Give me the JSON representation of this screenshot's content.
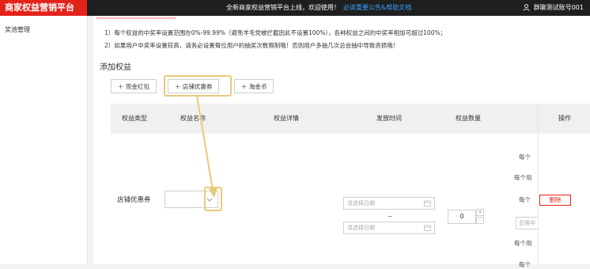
{
  "header": {
    "brand": "商家权益营销平台",
    "notice": "全新商家权益营销平台上线，欢迎使用！",
    "notice_link": "必读重要公告&帮助文档",
    "account": "群聊测试账号001"
  },
  "sidebar": {
    "items": [
      {
        "label": "奖池管理"
      }
    ]
  },
  "tips": {
    "line1": "1）每个权益的中奖率设置范围在0%-99.99%（避免羊毛党被拦截因此不设置100%），各种权益之间的中奖率相加可超过100%；",
    "line2": "2）如果用户中奖率设置较高，请务必设置每位用户的抽奖次数限制哦！否则用户多抽几次总会抽中导致资损哦！"
  },
  "section": {
    "title": "添加权益"
  },
  "buttons": {
    "cash_red_packet": "现金红包",
    "shop_coupon": "店铺优惠券",
    "taojinbi": "淘金币"
  },
  "table": {
    "headers": [
      "权益类型",
      "权益名称",
      "权益详情",
      "发放时间",
      "权益数量",
      "操作"
    ],
    "row": {
      "type": "店铺优惠券",
      "date_placeholder_start": "请选择日期",
      "date_separator": "~",
      "date_placeholder_end": "请选择日期",
      "quantity": "0",
      "right_texts": [
        "每个",
        "每个用",
        "每个",
        "总限中",
        "每个用",
        "每个"
      ],
      "delete_label": "删除"
    }
  },
  "colors": {
    "brand_red": "#e2231a",
    "highlight": "#e8c97a",
    "link_blue": "#3aa0ff"
  }
}
